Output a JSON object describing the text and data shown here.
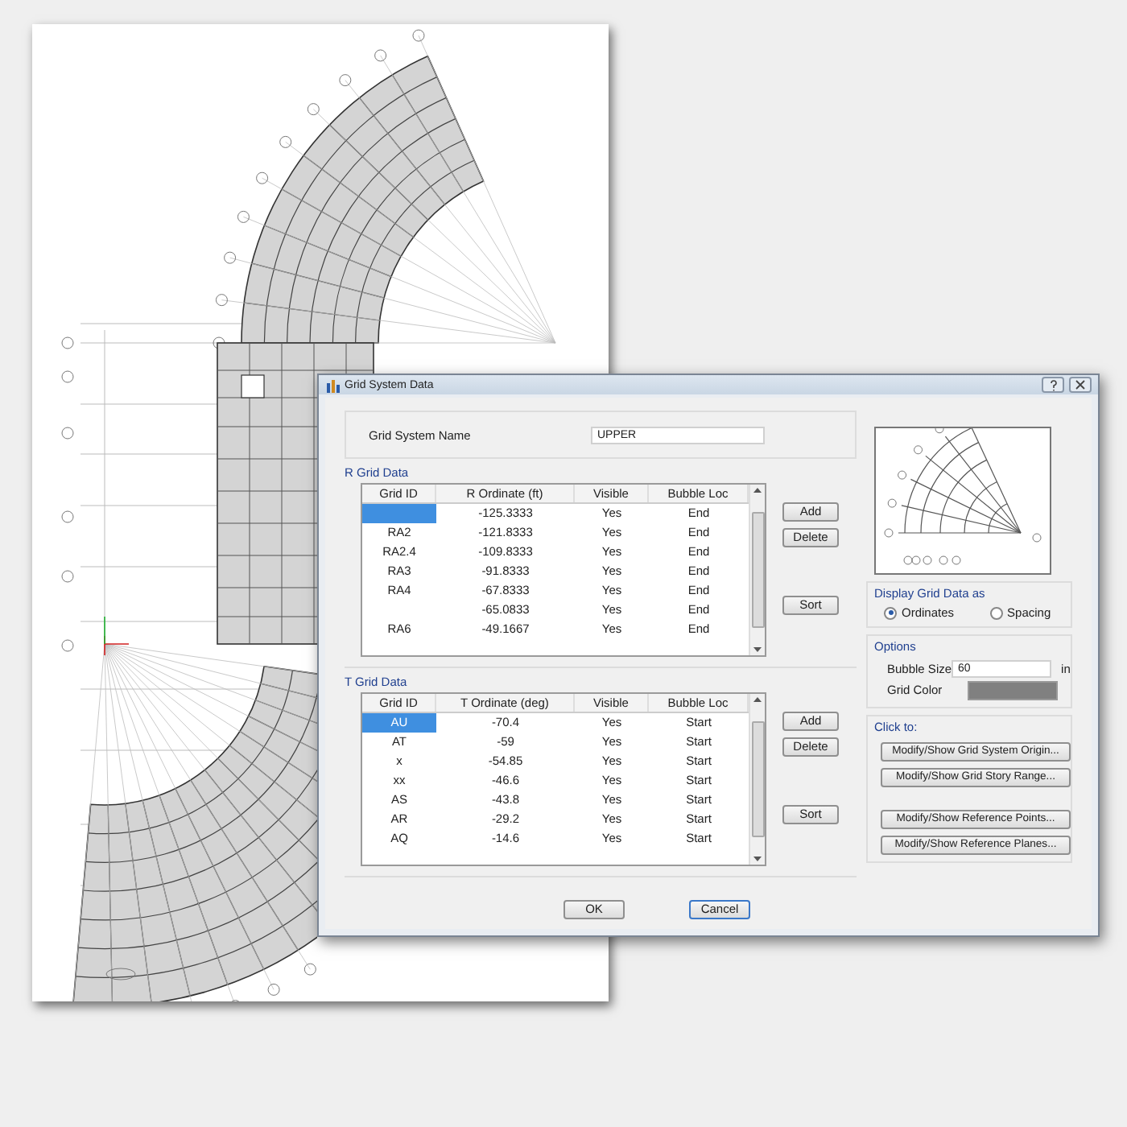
{
  "dialog": {
    "title": "Grid System Data",
    "grid_system_name": {
      "label": "Grid System Name",
      "value": "UPPER"
    },
    "r_grid": {
      "title": "R Grid Data",
      "columns": [
        "Grid ID",
        "R Ordinate  (ft)",
        "Visible",
        "Bubble Loc"
      ],
      "rows": [
        {
          "ordinate": "-125.3333",
          "visible": "Yes",
          "bubble_loc": "End",
          "selected": true
        },
        {
          "id": "RA2",
          "ordinate": "-121.8333",
          "visible": "Yes",
          "bubble_loc": "End",
          "selected": false
        },
        {
          "id": "RA2.4",
          "ordinate": "-109.8333",
          "visible": "Yes",
          "bubble_loc": "End",
          "selected": false
        },
        {
          "id": "RA3",
          "ordinate": "-91.8333",
          "visible": "Yes",
          "bubble_loc": "End",
          "selected": false
        },
        {
          "id": "RA4",
          "ordinate": "-67.8333",
          "visible": "Yes",
          "bubble_loc": "End",
          "selected": false
        },
        {
          "ordinate": "-65.0833",
          "visible": "Yes",
          "bubble_loc": "End",
          "selected": false
        },
        {
          "id": "RA6",
          "ordinate": "-49.1667",
          "visible": "Yes",
          "bubble_loc": "End",
          "selected": false
        }
      ],
      "buttons": [
        "Add",
        "Delete",
        "Sort"
      ]
    },
    "t_grid": {
      "title": "T Grid Data",
      "columns": [
        "Grid ID",
        "T Ordinate  (deg)",
        "Visible",
        "Bubble Loc"
      ],
      "rows": [
        {
          "id": "AU",
          "ordinate": "-70.4",
          "visible": "Yes",
          "bubble_loc": "Start",
          "selected": true
        },
        {
          "id": "AT",
          "ordinate": "-59",
          "visible": "Yes",
          "bubble_loc": "Start",
          "selected": false
        },
        {
          "id": "x",
          "ordinate": "-54.85",
          "visible": "Yes",
          "bubble_loc": "Start",
          "selected": false
        },
        {
          "id": "xx",
          "ordinate": "-46.6",
          "visible": "Yes",
          "bubble_loc": "Start",
          "selected": false
        },
        {
          "id": "AS",
          "ordinate": "-43.8",
          "visible": "Yes",
          "bubble_loc": "Start",
          "selected": false
        },
        {
          "id": "AR",
          "ordinate": "-29.2",
          "visible": "Yes",
          "bubble_loc": "Start",
          "selected": false
        },
        {
          "id": "AQ",
          "ordinate": "-14.6",
          "visible": "Yes",
          "bubble_loc": "Start",
          "selected": false
        }
      ],
      "buttons": [
        "Add",
        "Delete",
        "Sort"
      ]
    },
    "display_as": {
      "title": "Display Grid Data as",
      "options": [
        {
          "label": "Ordinates",
          "selected": true
        },
        {
          "label": "Spacing",
          "selected": false
        }
      ]
    },
    "options": {
      "title": "Options",
      "bubble_size": {
        "label": "Bubble Size",
        "value": "60",
        "unit": "in"
      },
      "grid_color": {
        "label": "Grid Color",
        "color": "#808080"
      }
    },
    "click_to": {
      "title": "Click to:",
      "groups": [
        [
          "Modify/Show Grid System Origin...",
          "Modify/Show Grid Story Range..."
        ],
        [
          "Modify/Show Reference Points...",
          "Modify/Show Reference Planes..."
        ]
      ]
    },
    "footer_buttons": [
      "OK",
      "Cancel"
    ]
  }
}
